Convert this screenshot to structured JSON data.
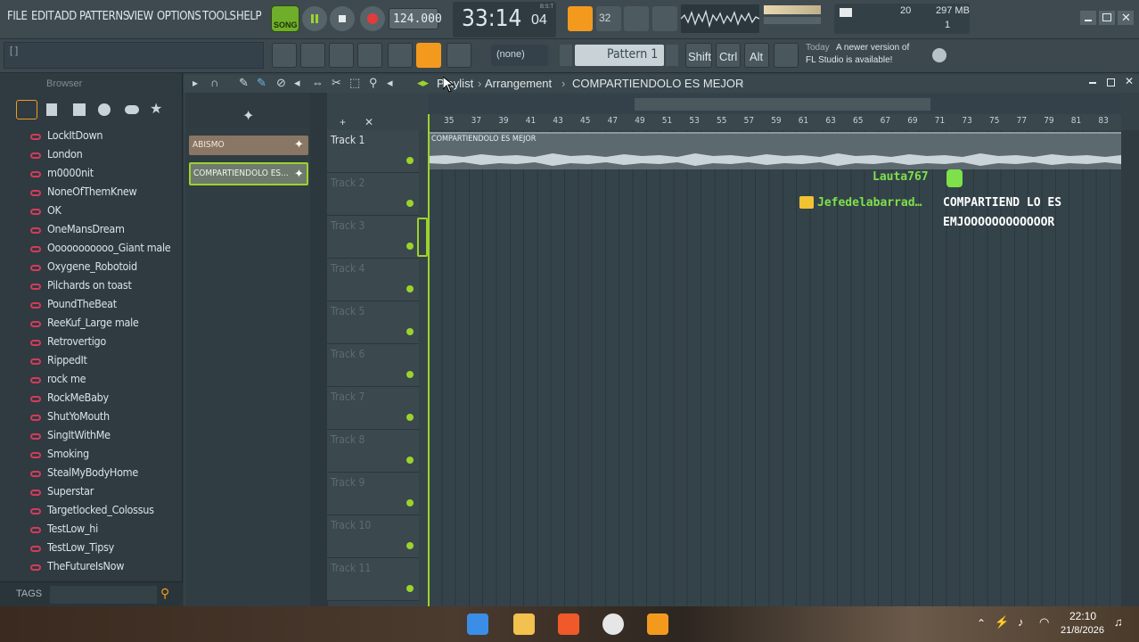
{
  "menu": {
    "items": [
      "FILE",
      "EDIT",
      "ADD",
      "PATTERNS",
      "VIEW",
      "OPTIONS",
      "TOOLS",
      "HELP"
    ],
    "song_label": "SONG",
    "tempo": "124.000",
    "time_main": "33:14",
    "time_sub": "04",
    "time_unit": "B:S:T",
    "cpu": "20",
    "memory": "297 MB",
    "polyphony": "1",
    "pattern_num": "32"
  },
  "toolbar2": {
    "hint": "[ ]",
    "none_label": "(none)",
    "pattern_label": "Pattern 1",
    "shift": "Shift",
    "ctrl": "Ctrl",
    "alt": "Alt",
    "news_today": "Today",
    "news_text_1": "A newer version of",
    "news_text_2": "FL Studio is available!"
  },
  "browser": {
    "title": "Browser",
    "tags_label": "TAGS",
    "items": [
      "LockItDown",
      "London",
      "m0000nit",
      "NoneOfThemKnew",
      "OK",
      "OneMansDream",
      "Ooooooooooo_Giant male",
      "Oxygene_Robotoid",
      "Pilchards on toast",
      "PoundTheBeat",
      "ReeKuf_Large male",
      "Retrovertigo",
      "RippedIt",
      "rock me",
      "RockMeBaby",
      "ShutYoMouth",
      "SingItWithMe",
      "Smoking",
      "StealMyBodyHome",
      "Superstar",
      "Targetlocked_Colossus",
      "TestLow_hi",
      "TestLow_Tipsy",
      "TheFutureIsNow"
    ]
  },
  "playlist": {
    "breadcrumb_1": "Playlist",
    "breadcrumb_sep": "›",
    "breadcrumb_2": "Arrangement",
    "breadcrumb_3": "COMPARTIENDOLO ES MEJOR",
    "patterns": [
      "ABISMO",
      "COMPARTIENDOLO ES..."
    ],
    "tracks": [
      "Track 1",
      "Track 2",
      "Track 3",
      "Track 4",
      "Track 5",
      "Track 6",
      "Track 7",
      "Track 8",
      "Track 9",
      "Track 10",
      "Track 11"
    ],
    "ruler": [
      "35",
      "37",
      "39",
      "41",
      "43",
      "45",
      "47",
      "49",
      "51",
      "53",
      "55",
      "57",
      "59",
      "61",
      "63",
      "65",
      "67",
      "69",
      "71",
      "73",
      "75",
      "77",
      "79",
      "81",
      "83"
    ],
    "clip_name": "COMPARTIENDOLO ES MEJOR"
  },
  "chat": {
    "user1": "Lauta767",
    "user2": "Jefedelabarrad…",
    "msg_line1": "COMPARTIEND LO ES",
    "msg_line2": "EMJOOOOOOOOOOOOR"
  },
  "taskbar": {
    "time": "22:10",
    "date": "21/8/2026"
  },
  "colors": {
    "accent_green": "#9bd32c",
    "accent_orange": "#f39a1e",
    "record_red": "#e23b3b",
    "chat_green": "#7ee04a"
  }
}
